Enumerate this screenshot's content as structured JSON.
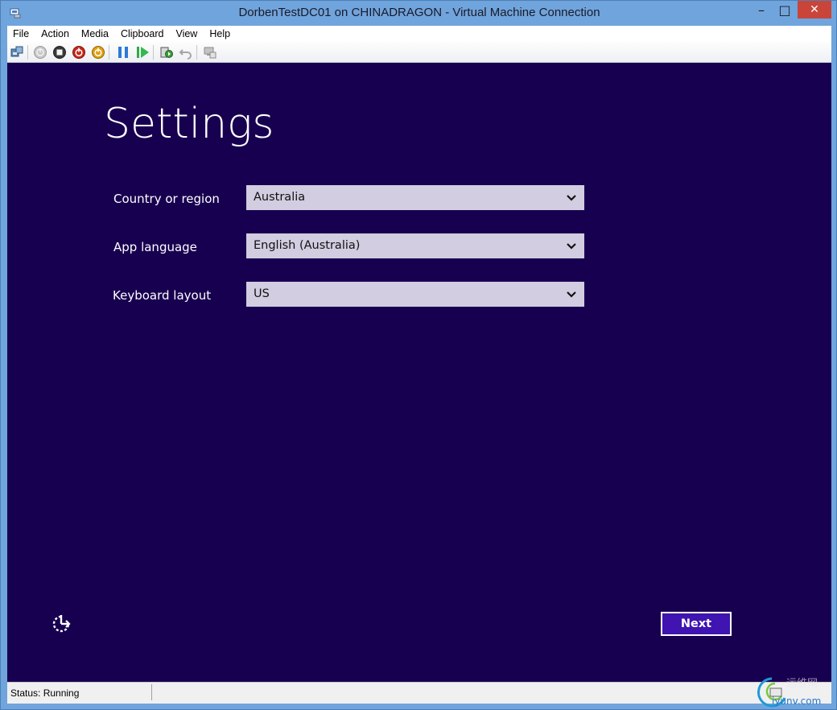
{
  "window": {
    "title": "DorbenTestDC01 on CHINADRAGON - Virtual Machine Connection",
    "controls": {
      "minimize": "–",
      "maximize": "□",
      "close": "✕"
    }
  },
  "menubar": {
    "items": [
      "File",
      "Action",
      "Media",
      "Clipboard",
      "View",
      "Help"
    ]
  },
  "toolbar": {
    "buttons": [
      "ctrl-alt-del-icon",
      "start-icon",
      "turn-off-icon",
      "shutdown-icon",
      "save-state-icon",
      "pause-icon",
      "resume-icon",
      "checkpoint-icon",
      "revert-icon",
      "enhanced-session-icon"
    ]
  },
  "setup": {
    "heading": "Settings",
    "country": {
      "label": "Country or region",
      "value": "Australia"
    },
    "app_language": {
      "label": "App language",
      "value": "English (Australia)"
    },
    "keyboard": {
      "label": "Keyboard layout",
      "value": "US"
    },
    "next_label": "Next"
  },
  "status": {
    "text": "Status: Running"
  },
  "watermark": {
    "text": "运维网",
    "subtext": "iyunv.com"
  },
  "colors": {
    "background": "#180050",
    "dropdown": "#d2cde0",
    "next_button": "#3f14b0",
    "titlebar": "#70a4dc"
  }
}
